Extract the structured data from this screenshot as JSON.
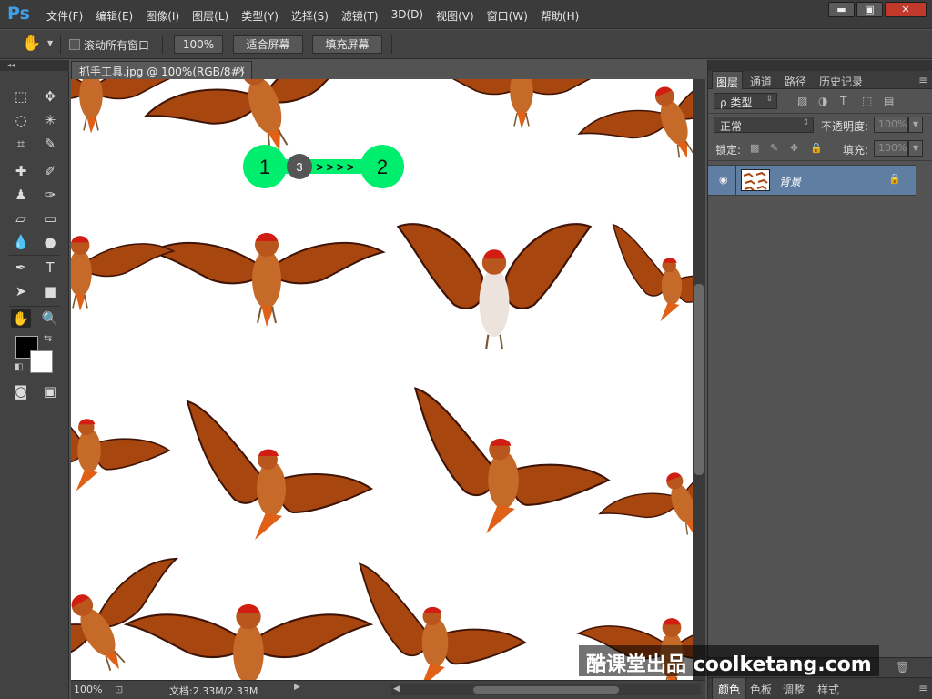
{
  "app": {
    "logo": "Ps"
  },
  "menu": [
    "文件(F)",
    "编辑(E)",
    "图像(I)",
    "图层(L)",
    "类型(Y)",
    "选择(S)",
    "滤镜(T)",
    "3D(D)",
    "视图(V)",
    "窗口(W)",
    "帮助(H)"
  ],
  "window_buttons": {
    "minimize": "▬",
    "maximize": "▣",
    "close": "✕"
  },
  "options": {
    "scroll_all_windows": "滚动所有窗口",
    "scroll_all_checked": false,
    "btn_100": "100%",
    "btn_fit": "适合屏幕",
    "btn_fill": "填充屏幕"
  },
  "tools_header": "◂◂",
  "document": {
    "tab": "抓手工具.jpg @ 100%(RGB/8#)",
    "close": "×"
  },
  "status": {
    "zoom": "100%",
    "doc_info": "文档:2.33M/2.33M"
  },
  "tutorial": {
    "step1": "1",
    "step2": "2",
    "step3": "3",
    "arrows": "> > > >",
    "color": "#00ee6e"
  },
  "panel": {
    "tabs": [
      "图层",
      "通道",
      "路径",
      "历史记录"
    ],
    "filter_kind": "ρ 类型",
    "blend_mode": "正常",
    "opacity_label": "不透明度:",
    "opacity_value": "100%",
    "lock_label": "锁定:",
    "fill_label": "填充:",
    "fill_value": "100%",
    "layer_name": "背景",
    "bottom_tabs": [
      "颜色",
      "色板",
      "调整",
      "样式"
    ]
  },
  "watermark": "酷课堂出品 coolketang.com",
  "colors": {
    "accent_selection": "#5f7ea2",
    "bird_wing": "#a8460f",
    "bird_cap": "#d21e12"
  }
}
